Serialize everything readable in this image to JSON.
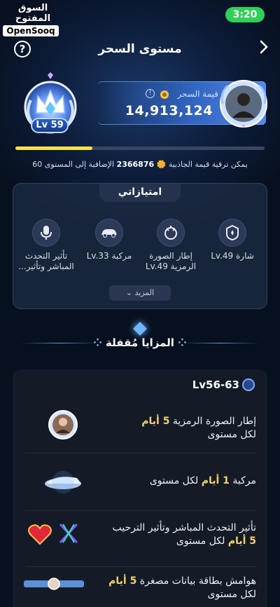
{
  "status_bar": {
    "time": "3:20"
  },
  "watermark": {
    "arabic": "السوق المفتوح",
    "english": "OpenSooq"
  },
  "header": {
    "title": "مستوى السحر",
    "help_icon": "?",
    "back_icon": "chevron-right"
  },
  "level": {
    "badge": "Lv 59"
  },
  "magic_value": {
    "label": "قيمة السحر",
    "value": "14,913,124"
  },
  "progress": {
    "fraction": 0.31
  },
  "upgrade_hint": {
    "prefix": "يمكن ترقية قيمة الجاذبية",
    "amount": "2366876",
    "suffix": "الإضافية إلى المستوى 60"
  },
  "privileges": {
    "title": "امتيازاتي",
    "items": [
      {
        "label": "شارة Lv.49",
        "icon": "badge-icon"
      },
      {
        "label": "إطار الصورة الرمزية Lv.49",
        "icon": "avatar-frame-icon"
      },
      {
        "label": "مركبة Lv.33",
        "icon": "vehicle-icon"
      },
      {
        "label": "تأثير التحدث المباشر وتأثير...",
        "icon": "microphone-icon"
      }
    ],
    "more": "المزيد"
  },
  "locked_section": {
    "title": "المزايا مُقفلة",
    "level_range": "Lv56-63",
    "rows": [
      {
        "text": "إطار الصورة الرمزية",
        "highlight": "5 أيام",
        "suffix": "لكل مستوى"
      },
      {
        "text": "مركبة",
        "highlight": "1 أيام",
        "suffix": "لكل مستوى"
      },
      {
        "text": "تأثير التحدث المباشر وتأثير الترحيب",
        "highlight": "5 أيام",
        "suffix": "لكل مستوى"
      },
      {
        "text": "هوامش بطاقة بيانات مصغرة",
        "highlight": "5 أيام",
        "suffix": "لكل مستوى"
      }
    ]
  },
  "colors": {
    "accent": "#6fb6ff",
    "progress": "#f4e24a",
    "status_time_bg": "#2fcf58",
    "highlight": "#f5d36a"
  }
}
